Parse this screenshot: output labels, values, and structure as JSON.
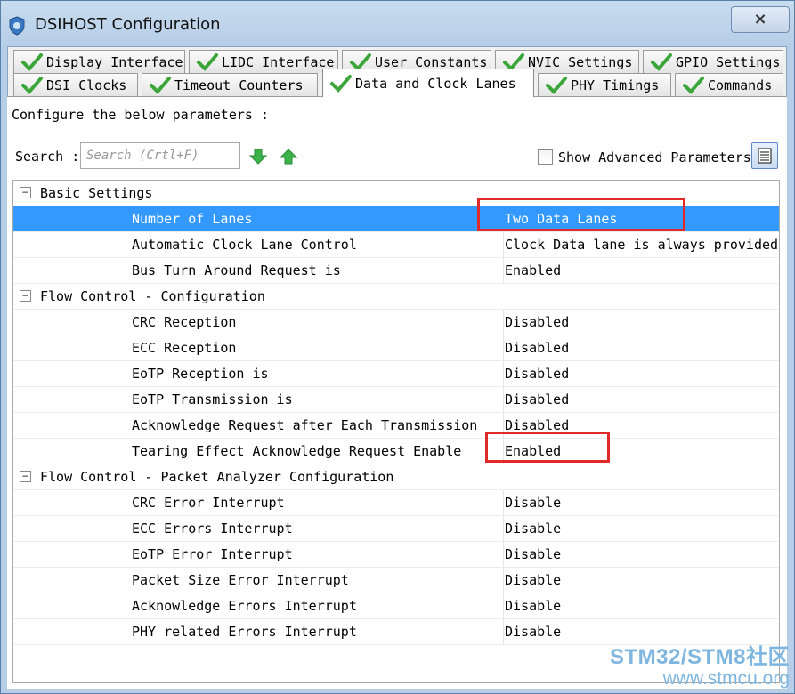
{
  "window": {
    "title": "DSIHOST Configuration",
    "close_label": "×"
  },
  "tabs_row1": [
    {
      "label": "Display Interface"
    },
    {
      "label": "LIDC Interface"
    },
    {
      "label": "User Constants"
    },
    {
      "label": "NVIC Settings"
    },
    {
      "label": "GPIO Settings"
    }
  ],
  "tabs_row2": [
    {
      "label": "DSI Clocks"
    },
    {
      "label": "Timeout Counters"
    },
    {
      "label": "Data and Clock Lanes",
      "active": true
    },
    {
      "label": "PHY Timings"
    },
    {
      "label": "Commands"
    }
  ],
  "configure_text": "Configure the below parameters :",
  "search": {
    "label": "Search :",
    "placeholder": "Search (Crtl+F)"
  },
  "advanced": {
    "label": "Show Advanced Parameters",
    "checked": false
  },
  "sections": [
    {
      "title": "Basic Settings",
      "rows": [
        {
          "name": "Number of Lanes",
          "value": "Two Data Lanes",
          "selected": true
        },
        {
          "name": "Automatic Clock Lane Control",
          "value": "Clock Data lane is always provided"
        },
        {
          "name": "Bus Turn Around Request is",
          "value": "Enabled"
        }
      ]
    },
    {
      "title": "Flow Control - Configuration",
      "rows": [
        {
          "name": "CRC Reception",
          "value": "Disabled"
        },
        {
          "name": "ECC Reception",
          "value": "Disabled"
        },
        {
          "name": "EoTP Reception is",
          "value": "Disabled"
        },
        {
          "name": "EoTP Transmission is",
          "value": "Disabled"
        },
        {
          "name": "Acknowledge Request after Each Transmission",
          "value": "Disabled"
        },
        {
          "name": "Tearing Effect Acknowledge Request Enable",
          "value": "Enabled"
        }
      ]
    },
    {
      "title": "Flow Control - Packet Analyzer Configuration",
      "rows": [
        {
          "name": "CRC Error Interrupt",
          "value": "Disable"
        },
        {
          "name": "ECC Errors Interrupt",
          "value": "Disable"
        },
        {
          "name": "EoTP Error Interrupt",
          "value": "Disable"
        },
        {
          "name": "Packet Size Error Interrupt",
          "value": "Disable"
        },
        {
          "name": "Acknowledge Errors Interrupt",
          "value": "Disable"
        },
        {
          "name": "PHY related Errors Interrupt",
          "value": "Disable"
        }
      ]
    }
  ],
  "watermark": {
    "line1": "STM32/STM8社区",
    "line2": "www.stmcu.org"
  },
  "colors": {
    "selection": "#3399ff",
    "highlight_box": "#e02a2a",
    "check_green": "#3aa63a"
  }
}
